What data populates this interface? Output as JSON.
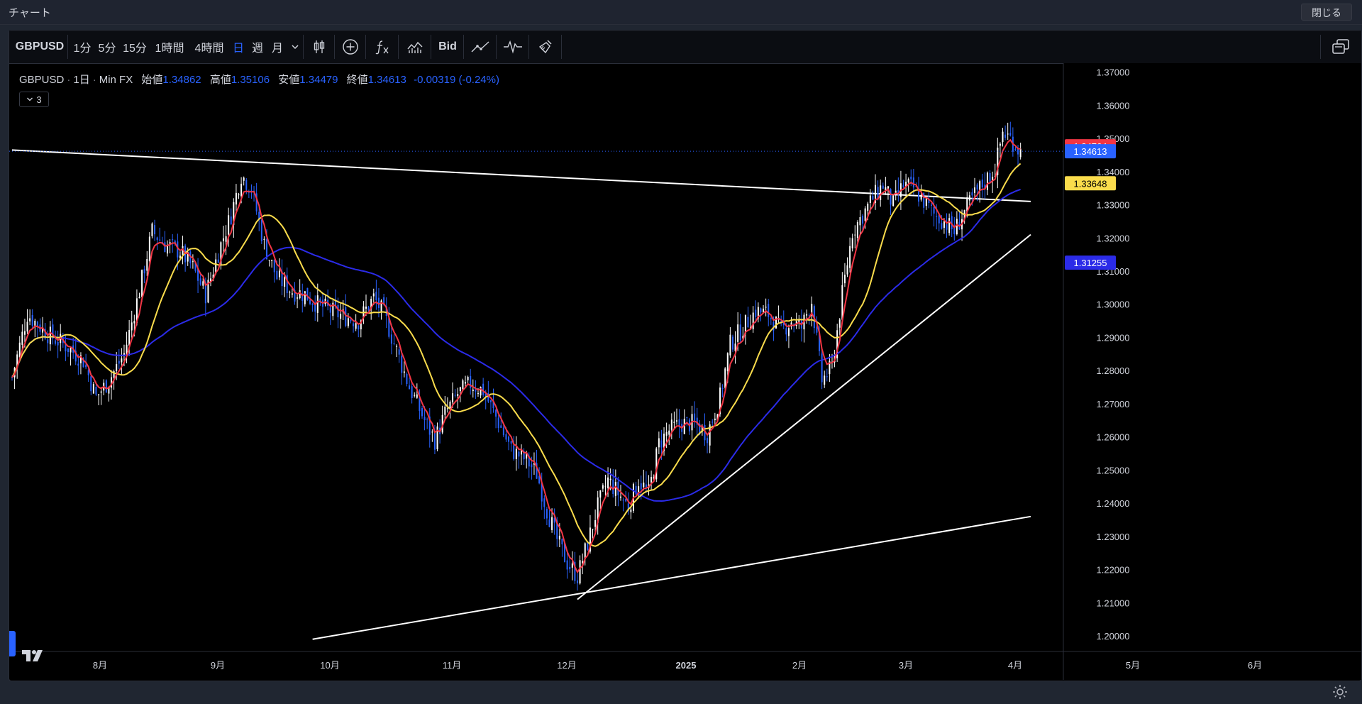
{
  "window": {
    "title": "チャート",
    "close_label": "閉じる"
  },
  "toolbar": {
    "symbol": "GBPUSD",
    "timeframes": [
      "1分",
      "5分",
      "15分",
      "1時間",
      "4時間",
      "日",
      "週",
      "月"
    ],
    "active_timeframe": "日",
    "bid_label": "Bid",
    "icons": [
      "chevron-down-icon",
      "candlestick-icon",
      "add-circle-icon",
      "indicator-fx-icon",
      "chart-style-icon",
      "trend-line-icon",
      "wave-icon",
      "broom-icon",
      "layout-icon"
    ]
  },
  "legend": {
    "symbol": "GBPUSD",
    "interval": "1日",
    "source": "Min FX",
    "open_label": "始値",
    "open": "1.34862",
    "high_label": "高値",
    "high": "1.35106",
    "low_label": "安値",
    "low": "1.34479",
    "close_label": "終値",
    "close": "1.34613",
    "change": "-0.00319 (-0.24%)",
    "indicator_count": "3"
  },
  "colors": {
    "up_candle": "#ffffff",
    "down_candle": "#2962ff",
    "ma_fast": "#f23645",
    "ma_mid": "#fadc4c",
    "ma_slow": "#2b2be8",
    "trendline": "#ffffff",
    "accent": "#2962ff"
  },
  "chart_data": {
    "type": "candlestick",
    "y_axis": {
      "min": 1.195,
      "max": 1.375,
      "ticks": [
        "1.20000",
        "1.21000",
        "1.22000",
        "1.23000",
        "1.24000",
        "1.25000",
        "1.26000",
        "1.27000",
        "1.28000",
        "1.29000",
        "1.30000",
        "1.31000",
        "1.32000",
        "1.33000",
        "1.34000",
        "1.35000",
        "1.36000",
        "1.37000"
      ]
    },
    "x_axis": {
      "labels": [
        "8月",
        "9月",
        "10月",
        "11月",
        "12月",
        "2025",
        "2月",
        "3月",
        "4月",
        "5月",
        "6月"
      ]
    },
    "price_tags": [
      {
        "value": 1.34764,
        "label": "1.34764",
        "color": "#f23645",
        "text_color": "#ffffff"
      },
      {
        "value": 1.34613,
        "label": "1.34613",
        "color": "#2962ff",
        "text_color": "#ffffff"
      },
      {
        "value": 1.33648,
        "label": "1.33648",
        "color": "#fadc4c",
        "text_color": "#000000"
      },
      {
        "value": 1.31255,
        "label": "1.31255",
        "color": "#2b2be8",
        "text_color": "#ffffff"
      }
    ],
    "last_price": 1.34613,
    "close_path": [
      [
        0,
        1.278
      ],
      [
        6,
        1.297
      ],
      [
        14,
        1.291
      ],
      [
        22,
        1.287
      ],
      [
        28,
        1.283
      ],
      [
        33,
        1.272
      ],
      [
        38,
        1.277
      ],
      [
        44,
        1.285
      ],
      [
        50,
        1.304
      ],
      [
        55,
        1.322
      ],
      [
        60,
        1.318
      ],
      [
        66,
        1.316
      ],
      [
        71,
        1.311
      ],
      [
        76,
        1.303
      ],
      [
        82,
        1.318
      ],
      [
        86,
        1.327
      ],
      [
        90,
        1.339
      ],
      [
        94,
        1.335
      ],
      [
        99,
        1.318
      ],
      [
        104,
        1.308
      ],
      [
        110,
        1.304
      ],
      [
        115,
        1.303
      ],
      [
        120,
        1.3
      ],
      [
        128,
        1.297
      ],
      [
        136,
        1.295
      ],
      [
        142,
        1.302
      ],
      [
        146,
        1.297
      ],
      [
        151,
        1.286
      ],
      [
        156,
        1.275
      ],
      [
        162,
        1.265
      ],
      [
        166,
        1.259
      ],
      [
        170,
        1.267
      ],
      [
        175,
        1.273
      ],
      [
        180,
        1.276
      ],
      [
        185,
        1.274
      ],
      [
        190,
        1.266
      ],
      [
        196,
        1.256
      ],
      [
        202,
        1.253
      ],
      [
        206,
        1.249
      ],
      [
        210,
        1.238
      ],
      [
        214,
        1.229
      ],
      [
        218,
        1.222
      ],
      [
        222,
        1.218
      ],
      [
        226,
        1.228
      ],
      [
        230,
        1.239
      ],
      [
        234,
        1.247
      ],
      [
        238,
        1.243
      ],
      [
        242,
        1.239
      ],
      [
        246,
        1.247
      ],
      [
        250,
        1.243
      ],
      [
        254,
        1.258
      ],
      [
        258,
        1.262
      ],
      [
        263,
        1.264
      ],
      [
        268,
        1.264
      ],
      [
        273,
        1.261
      ],
      [
        278,
        1.272
      ],
      [
        282,
        1.288
      ],
      [
        287,
        1.293
      ],
      [
        292,
        1.298
      ],
      [
        297,
        1.297
      ],
      [
        302,
        1.292
      ],
      [
        306,
        1.295
      ],
      [
        310,
        1.293
      ],
      [
        314,
        1.301
      ],
      [
        318,
        1.277
      ],
      [
        322,
        1.281
      ],
      [
        326,
        1.303
      ],
      [
        330,
        1.322
      ],
      [
        334,
        1.327
      ],
      [
        338,
        1.332
      ],
      [
        342,
        1.336
      ],
      [
        346,
        1.33
      ],
      [
        350,
        1.336
      ],
      [
        354,
        1.335
      ],
      [
        358,
        1.331
      ],
      [
        362,
        1.327
      ],
      [
        366,
        1.325
      ],
      [
        370,
        1.322
      ],
      [
        374,
        1.328
      ],
      [
        378,
        1.333
      ],
      [
        382,
        1.337
      ],
      [
        386,
        1.341
      ],
      [
        389,
        1.352
      ],
      [
        392,
        1.35
      ],
      [
        396,
        1.346
      ]
    ],
    "n_candles": 400,
    "trendlines": [
      {
        "from": [
          0,
          1.3465
        ],
        "to": [
          400,
          1.331
        ]
      },
      {
        "from": [
          222,
          1.211
        ],
        "to": [
          400,
          1.321
        ]
      },
      {
        "from": [
          118,
          1.199
        ],
        "to": [
          400,
          1.236
        ]
      }
    ]
  }
}
